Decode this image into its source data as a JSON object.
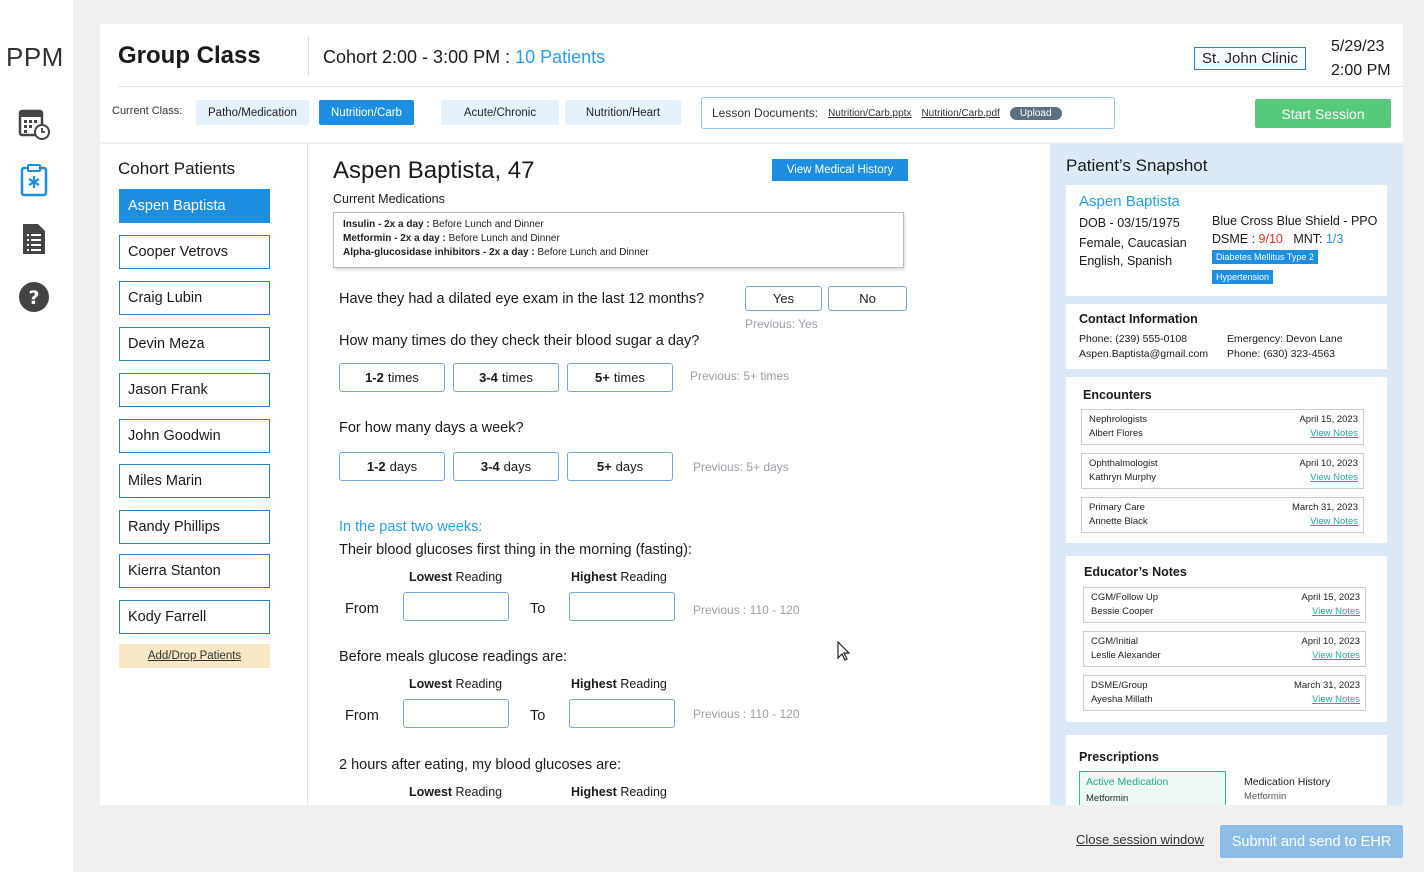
{
  "app": {
    "logo": "PPM"
  },
  "nav": {
    "icons": [
      "calendar-clock-icon",
      "clipboard-medical-icon",
      "document-list-icon",
      "help-icon"
    ]
  },
  "header": {
    "title": "Group Class",
    "cohort_prefix": "Cohort 2:00 - 3:00 PM : ",
    "cohort_patients": "10 Patients",
    "clinic": "St. John Clinic",
    "date": "5/29/23",
    "time": "2:00 PM",
    "current_class_label": "Current Class:",
    "classes": [
      "Patho/Medication",
      "Nutrition/Carb",
      "Acute/Chronic",
      "Nutrition/Heart"
    ],
    "active_class": "Nutrition/Carb",
    "lesson_label": "Lesson Documents:",
    "lesson_files": [
      "Nutrition/Carb.pptx",
      "Nutrition/Carb.pdf"
    ],
    "upload_label": "Upload",
    "start_session": "Start Session"
  },
  "cohort": {
    "title": "Cohort Patients",
    "patients": [
      "Aspen Baptista",
      "Cooper Vetrovs",
      "Craig Lubin",
      "Devin Meza",
      "Jason Frank",
      "John Goodwin",
      "Miles Marin",
      "Randy Phillips",
      "Kierra Stanton",
      "Kody Farrell"
    ],
    "selected": "Aspen Baptista",
    "add_drop": "Add/Drop Patients"
  },
  "detail": {
    "patient_title": "Aspen Baptista, 47",
    "view_history": "View Medical History",
    "current_meds_label": "Current Medications",
    "meds": [
      {
        "name": "Insulin - 2x a day :",
        "note": " Before Lunch and Dinner"
      },
      {
        "name": "Metformin - 2x a day :",
        "note": " Before Lunch and Dinner"
      },
      {
        "name": "Alpha-glucosidase inhibitors - 2x a day :",
        "note": " Before Lunch and Dinner"
      }
    ],
    "q_eye": "Have they had a dilated eye exam in the last 12 months?",
    "yes": "Yes",
    "no": "No",
    "prev_eye": "Previous: Yes",
    "q_check": "How many times do they check their blood sugar a day?",
    "times_options": [
      {
        "num": "1-2",
        "unit": "times"
      },
      {
        "num": "3-4",
        "unit": "times"
      },
      {
        "num": "5+",
        "unit": "times"
      }
    ],
    "prev_times": "Previous: 5+ times",
    "q_days": "For how many days a week?",
    "days_options": [
      {
        "num": "1-2",
        "unit": "days"
      },
      {
        "num": "3-4",
        "unit": "days"
      },
      {
        "num": "5+",
        "unit": "days"
      }
    ],
    "prev_days": "Previous: 5+ days",
    "past_two_weeks": "In the past two weeks:",
    "q_fasting": "Their blood glucoses first thing in the morning (fasting):",
    "lowest_bold": "Lowest",
    "highest_bold": "Highest",
    "reading": " Reading",
    "from": "From",
    "to": "To",
    "prev_fasting": "Previous : 110 - 120",
    "q_before": "Before meals glucose readings are:",
    "prev_before": "Previous : 110 - 120",
    "q_after": "2 hours after eating, my blood glucoses are:"
  },
  "snapshot": {
    "title": "Patient’s Snapshot",
    "name": "Aspen Baptista",
    "dob": "DOB - 03/15/1975",
    "sex_race": "Female, Caucasian",
    "languages": "English, Spanish",
    "insurance": "Blue Cross Blue Shield - PPO",
    "dsme_label": "DSME : ",
    "dsme_value": "9/10",
    "mnt_label": "MNT: ",
    "mnt_value": "1/3",
    "tags": [
      "Diabetes Mellitus Type 2",
      "Hypertension"
    ],
    "contact_title": "Contact Information",
    "phone": "Phone: (239) 555-0108",
    "email": "Aspen.Baptista@gmail.com",
    "emergency": "Emergency: Devon Lane",
    "emergency_phone": "Phone: (630) 323-4563",
    "encounters_title": "Encounters",
    "encounters": [
      {
        "type": "Nephrologists",
        "person": "Albert Flores",
        "date": "April 15, 2023",
        "link": "View Notes"
      },
      {
        "type": "Ophthalmologist",
        "person": "Kathryn Murphy",
        "date": "April 10, 2023",
        "link": "View Notes"
      },
      {
        "type": "Primary Care",
        "person": "Annette Black",
        "date": "March 31, 2023",
        "link": "View Notes"
      }
    ],
    "notes_title": "Educator’s Notes",
    "notes": [
      {
        "type": "CGM/Follow Up",
        "person": "Bessie Cooper",
        "date": "April 15, 2023",
        "link": "View Notes"
      },
      {
        "type": "CGM/Initial",
        "person": "Leslie Alexander",
        "date": "April 10, 2023",
        "link": "View Notes"
      },
      {
        "type": "DSME/Group",
        "person": "Ayesha Millath",
        "date": "March 31, 2023",
        "link": "View Notes"
      }
    ],
    "rx_title": "Prescriptions",
    "rx_active_label": "Active Medication",
    "rx_active_value": "Metformin",
    "rx_history_label": "Medication History",
    "rx_history_value": "Metformin"
  },
  "footer": {
    "close": "Close session window",
    "submit": "Submit and send to EHR"
  },
  "colors": {
    "accent": "#1e8fe0",
    "start": "#57c97b",
    "submit": "#8bbde6",
    "alert": "#e0302b",
    "link": "#2aa3a3"
  }
}
